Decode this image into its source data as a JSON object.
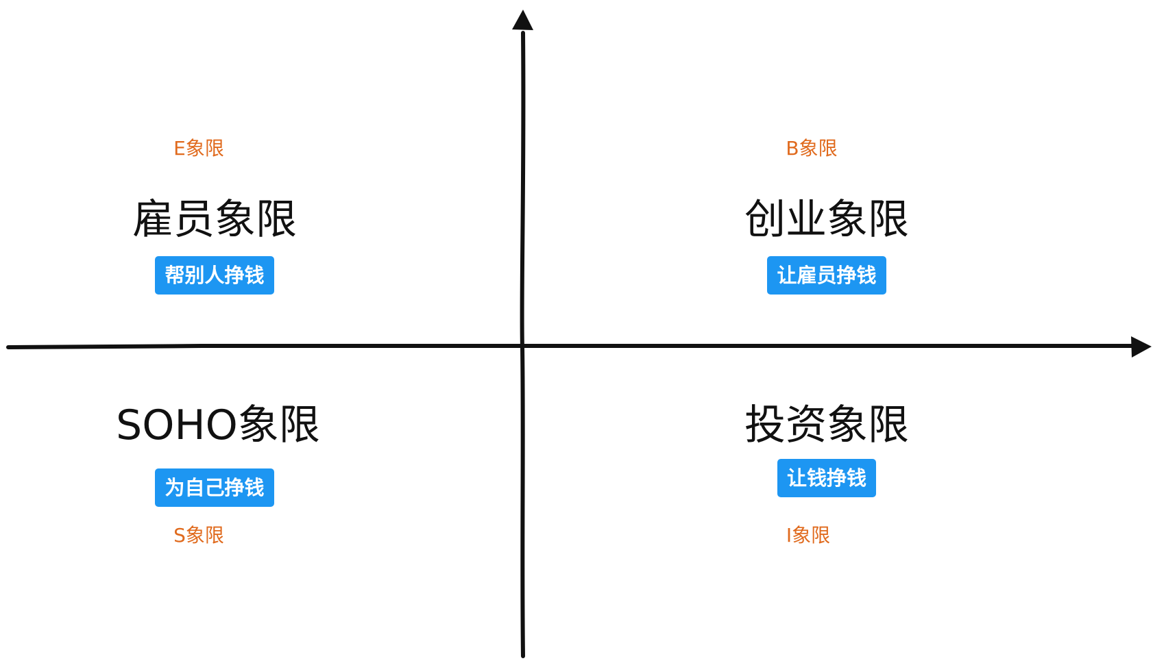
{
  "quadrants": {
    "top_left": {
      "code": "E象限",
      "title": "雇员象限",
      "tag": "帮别人挣钱"
    },
    "top_right": {
      "code": "B象限",
      "title": "创业象限",
      "tag": "让雇员挣钱"
    },
    "bottom_left": {
      "code": "S象限",
      "title": "SOHO象限",
      "tag": "为自己挣钱"
    },
    "bottom_right": {
      "code": "I象限",
      "title": "投资象限",
      "tag": "让钱挣钱"
    }
  },
  "colors": {
    "axis": "#111111",
    "code_text": "#e06a1d",
    "tag_background": "#1d96f2",
    "tag_text": "#ffffff",
    "title_text": "#111111"
  },
  "icons": {
    "vertical_arrow": "arrowhead-up-icon",
    "horizontal_arrow": "arrowhead-right-icon"
  }
}
